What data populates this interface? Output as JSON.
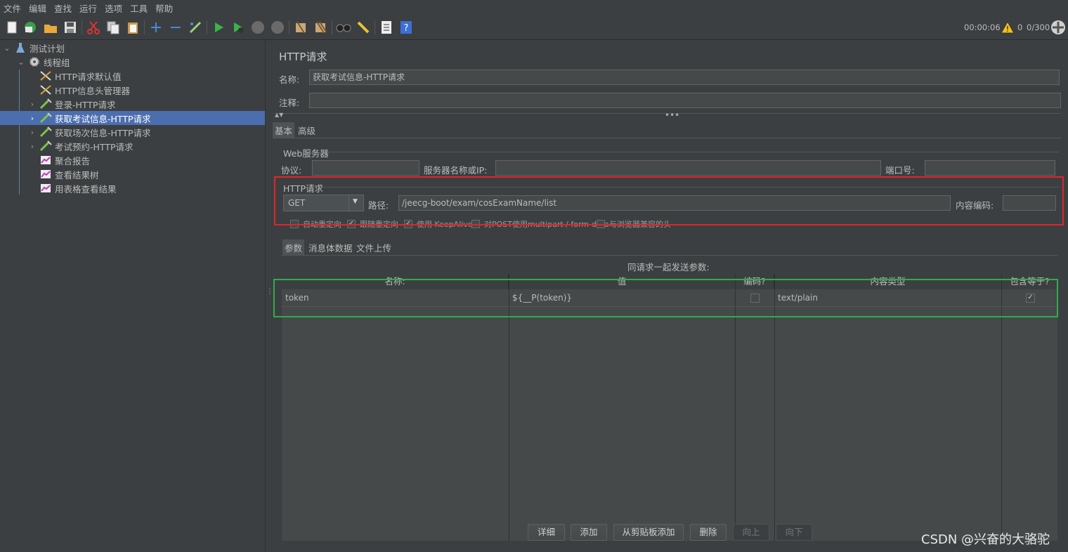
{
  "menu": [
    "文件",
    "编辑",
    "查找",
    "运行",
    "选项",
    "工具",
    "帮助"
  ],
  "status": {
    "elapsed": "00:00:06",
    "warnings": "0",
    "threads": "0/300"
  },
  "tree": {
    "root": "测试计划",
    "thread_group": "线程组",
    "items": [
      {
        "label": "HTTP请求默认值"
      },
      {
        "label": "HTTP信息头管理器"
      },
      {
        "label": "登录-HTTP请求"
      },
      {
        "label": "获取考试信息-HTTP请求"
      },
      {
        "label": "获取场次信息-HTTP请求"
      },
      {
        "label": "考试预约-HTTP请求"
      },
      {
        "label": "聚合报告"
      },
      {
        "label": "查看结果树"
      },
      {
        "label": "用表格查看结果"
      }
    ],
    "selected": "获取考试信息-HTTP请求"
  },
  "panel": {
    "title": "HTTP请求",
    "name_label": "名称:",
    "name_value": "获取考试信息-HTTP请求",
    "comment_label": "注释:",
    "comment_value": "",
    "tabs": [
      "基本",
      "高级"
    ],
    "active_tab": "基本"
  },
  "web_server": {
    "group_title": "Web服务器",
    "protocol_label": "协议:",
    "protocol_value": "",
    "server_label": "服务器名称或IP:",
    "server_value": "",
    "port_label": "端口号:",
    "port_value": ""
  },
  "http_request": {
    "group_title": "HTTP请求",
    "method": "GET",
    "path_label": "路径:",
    "path_value": "/jeecg-boot/exam/cosExamName/list",
    "encoding_label": "内容编码:",
    "encoding_value": "",
    "options": [
      {
        "label": "自动重定向",
        "checked": false
      },
      {
        "label": "跟随重定向",
        "checked": true
      },
      {
        "label": "使用 KeepAlive",
        "checked": true
      },
      {
        "label": "对POST使用multipart / form-data",
        "checked": false
      },
      {
        "label": "与浏览器兼容的头",
        "checked": false
      }
    ]
  },
  "param_tabs": [
    "参数",
    "消息体数据",
    "文件上传"
  ],
  "active_param_tab": "参数",
  "params": {
    "caption": "同请求一起发送参数:",
    "columns": [
      "名称:",
      "值",
      "编码?",
      "内容类型",
      "包含等于?"
    ],
    "rows": [
      {
        "name": "token",
        "value": "${__P(token)}",
        "encode": false,
        "content_type": "text/plain",
        "include_equals": true
      }
    ]
  },
  "buttons": [
    {
      "label": "详细",
      "enabled": true
    },
    {
      "label": "添加",
      "enabled": true
    },
    {
      "label": "从剪贴板添加",
      "enabled": true
    },
    {
      "label": "删除",
      "enabled": true
    },
    {
      "label": "向上",
      "enabled": false
    },
    {
      "label": "向下",
      "enabled": false
    }
  ],
  "watermark": "CSDN @兴奋的大骆驼",
  "colors": {
    "background": "#3c3f41",
    "selection": "#4b6eaf",
    "highlight_red": "#e0252a",
    "highlight_green": "#2cae4a"
  }
}
